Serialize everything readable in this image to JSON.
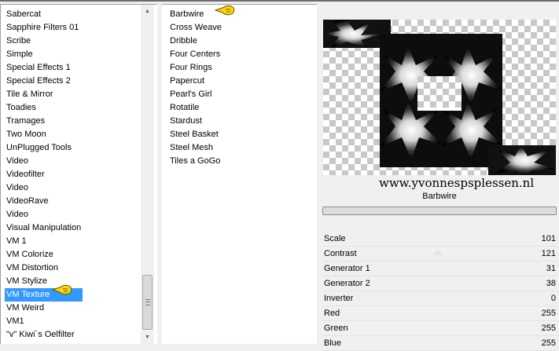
{
  "categories": {
    "items": [
      "Sabercat",
      "Sapphire Filters 01",
      "Scribe",
      "Simple",
      "Special Effects 1",
      "Special Effects 2",
      "Tile & Mirror",
      "Toadies",
      "Tramages",
      "Two Moon",
      "UnPlugged Tools",
      "Video",
      "Videofilter",
      "Video",
      "VideoRave",
      "Video",
      "Visual Manipulation",
      "VM 1",
      "VM Colorize",
      "VM Distortion",
      "VM Stylize",
      "VM Texture",
      "VM Weird",
      "VM1",
      "\"v\" Kiwi`s Oelfilter"
    ],
    "selected": "VM Texture"
  },
  "filters": {
    "items": [
      "Barbwire",
      "Cross Weave",
      "Dribble",
      "Four Centers",
      "Four Rings",
      "Papercut",
      "Pearl's Girl",
      "Rotatile",
      "Stardust",
      "Steel Basket",
      "Steel Mesh",
      "Tiles a GoGo"
    ],
    "selected": "Barbwire"
  },
  "preview": {
    "watermark": "www.yvonnespsplessen.nl",
    "filter_name": "Barbwire"
  },
  "parameters": [
    {
      "label": "Scale",
      "value": "101"
    },
    {
      "label": "Contrast",
      "value": "121"
    },
    {
      "label": "Generator 1",
      "value": "31"
    },
    {
      "label": "Generator 2",
      "value": "38"
    },
    {
      "label": "Inverter",
      "value": "0"
    },
    {
      "label": "Red",
      "value": "255"
    },
    {
      "label": "Green",
      "value": "255"
    },
    {
      "label": "Blue",
      "value": "255"
    }
  ],
  "colors": {
    "selection": "#3399ff",
    "pointer": "#ffd800"
  }
}
